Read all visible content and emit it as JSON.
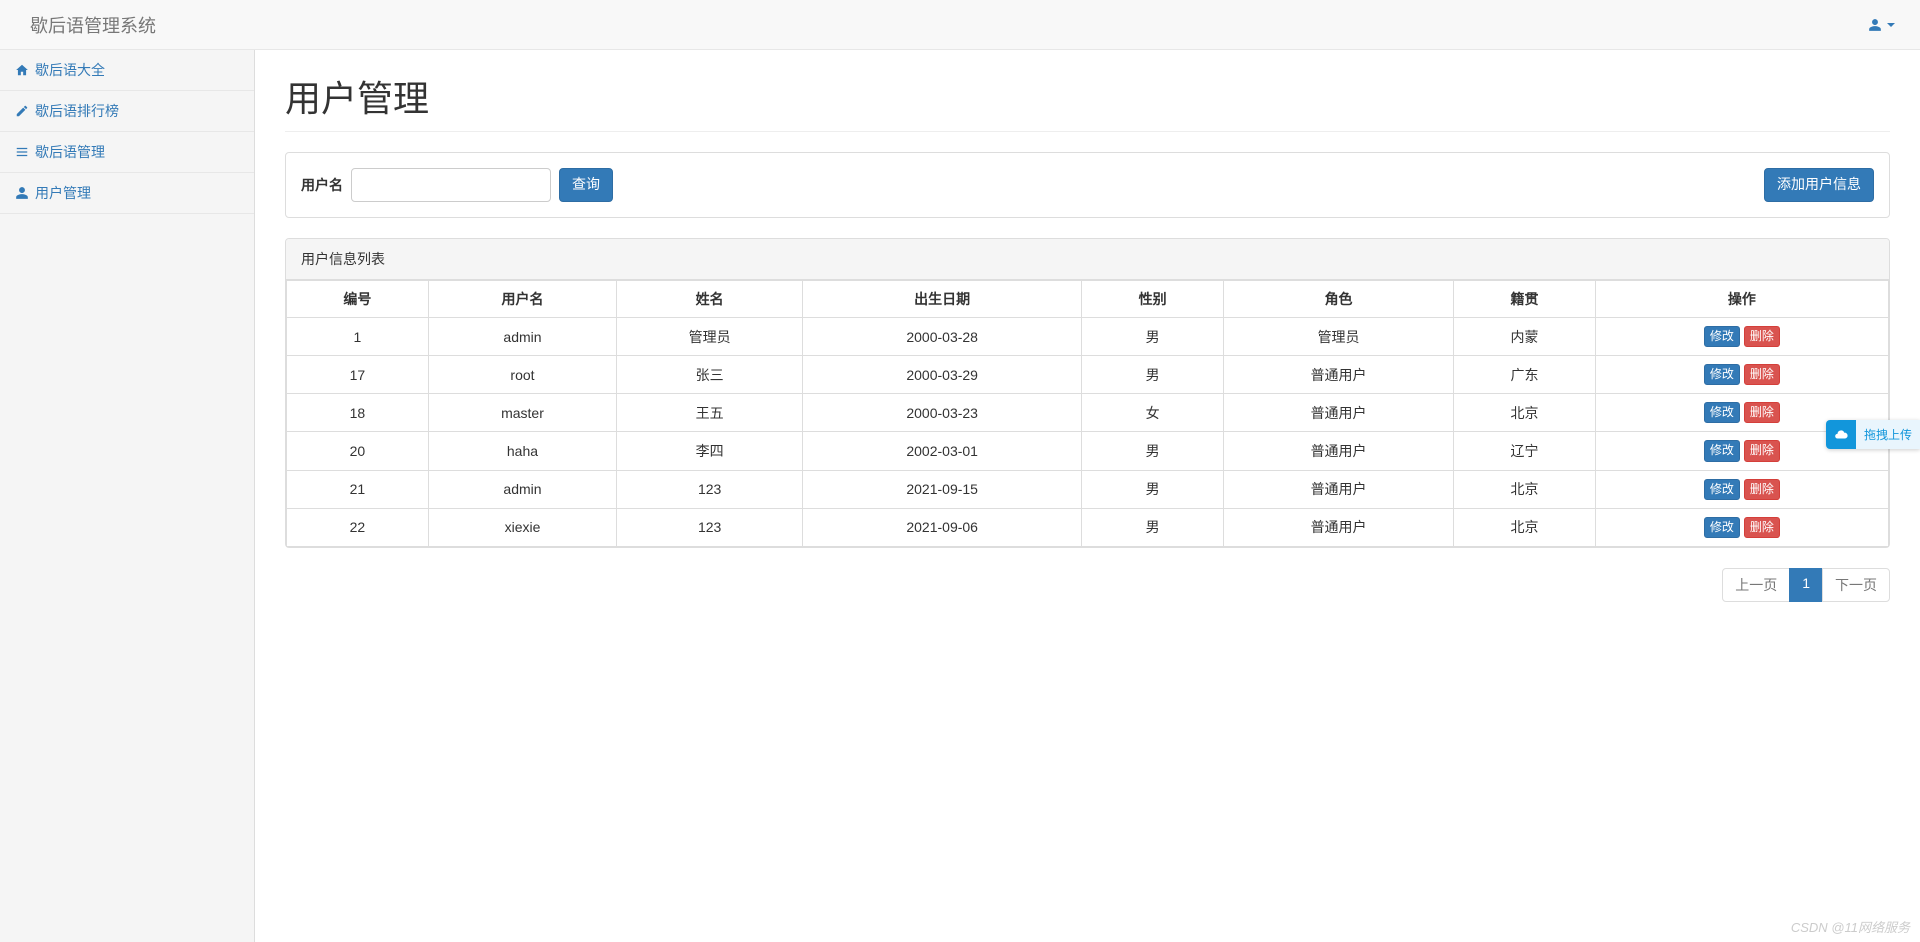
{
  "app": {
    "title": "歇后语管理系统"
  },
  "sidebar": {
    "items": [
      {
        "label": "歇后语大全",
        "icon": "home"
      },
      {
        "label": "歇后语排行榜",
        "icon": "edit"
      },
      {
        "label": "歇后语管理",
        "icon": "list"
      },
      {
        "label": "用户管理",
        "icon": "user"
      }
    ]
  },
  "page": {
    "title": "用户管理"
  },
  "search": {
    "label": "用户名",
    "value": "",
    "button": "查询",
    "add_button": "添加用户信息"
  },
  "table": {
    "panel_title": "用户信息列表",
    "headers": [
      "编号",
      "用户名",
      "姓名",
      "出生日期",
      "性别",
      "角色",
      "籍贯",
      "操作"
    ],
    "edit_label": "修改",
    "delete_label": "删除",
    "rows": [
      {
        "id": "1",
        "username": "admin",
        "name": "管理员",
        "birth": "2000-03-28",
        "gender": "男",
        "role": "管理员",
        "origin": "内蒙"
      },
      {
        "id": "17",
        "username": "root",
        "name": "张三",
        "birth": "2000-03-29",
        "gender": "男",
        "role": "普通用户",
        "origin": "广东"
      },
      {
        "id": "18",
        "username": "master",
        "name": "王五",
        "birth": "2000-03-23",
        "gender": "女",
        "role": "普通用户",
        "origin": "北京"
      },
      {
        "id": "20",
        "username": "haha",
        "name": "李四",
        "birth": "2002-03-01",
        "gender": "男",
        "role": "普通用户",
        "origin": "辽宁"
      },
      {
        "id": "21",
        "username": "admin",
        "name": "123",
        "birth": "2021-09-15",
        "gender": "男",
        "role": "普通用户",
        "origin": "北京"
      },
      {
        "id": "22",
        "username": "xiexie",
        "name": "123",
        "birth": "2021-09-06",
        "gender": "男",
        "role": "普通用户",
        "origin": "北京"
      }
    ]
  },
  "pagination": {
    "prev": "上一页",
    "next": "下一页",
    "current": "1"
  },
  "upload_widget": {
    "label": "拖拽上传"
  },
  "watermark": "CSDN @11网络服务"
}
